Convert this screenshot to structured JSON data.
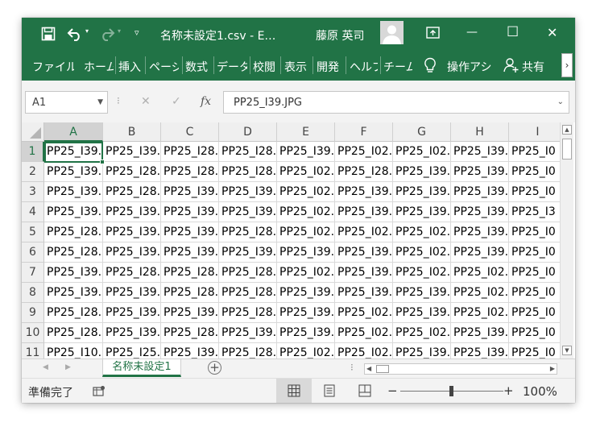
{
  "titlebar": {
    "file_title": "名称未設定1.csv  -  E…",
    "user_name": "藤原 英司",
    "minimize_label": "—",
    "maximize_label": "☐",
    "close_label": "✕"
  },
  "ribbon": {
    "tabs": [
      "ファイル",
      "ホーム",
      "挿入",
      "ページ",
      "数式",
      "データ",
      "校閲",
      "表示",
      "開発",
      "ヘルプ",
      "チーム"
    ],
    "tell_me": "操作アシ",
    "share": "共有",
    "more": "›"
  },
  "formula_bar": {
    "name_box": "A1",
    "fx_label": "fx",
    "cancel_label": "✕",
    "enter_label": "✓",
    "value": "PP25_I39.JPG"
  },
  "sheet": {
    "columns": [
      "A",
      "B",
      "C",
      "D",
      "E",
      "F",
      "G",
      "H",
      "I"
    ],
    "rows": [
      {
        "num": "1",
        "cells": [
          "PP25_I39.",
          "PP25_I39.",
          "PP25_I28.",
          "PP25_I28.",
          "PP25_I39.",
          "PP25_I02.",
          "PP25_I02.",
          "PP25_I39.",
          "PP25_I0"
        ]
      },
      {
        "num": "2",
        "cells": [
          "PP25_I39.",
          "PP25_I28.",
          "PP25_I28.",
          "PP25_I28.",
          "PP25_I02.",
          "PP25_I28.",
          "PP25_I39.",
          "PP25_I39.",
          "PP25_I0"
        ]
      },
      {
        "num": "3",
        "cells": [
          "PP25_I39.",
          "PP25_I28.",
          "PP25_I39.",
          "PP25_I39.",
          "PP25_I02.",
          "PP25_I39.",
          "PP25_I39.",
          "PP25_I39.",
          "PP25_I0"
        ]
      },
      {
        "num": "4",
        "cells": [
          "PP25_I39.",
          "PP25_I39.",
          "PP25_I39.",
          "PP25_I39.",
          "PP25_I02.",
          "PP25_I39.",
          "PP25_I39.",
          "PP25_I39.",
          "PP25_I3"
        ]
      },
      {
        "num": "5",
        "cells": [
          "PP25_I28.",
          "PP25_I39.",
          "PP25_I39.",
          "PP25_I28.",
          "PP25_I02.",
          "PP25_I02.",
          "PP25_I02.",
          "PP25_I39.",
          "PP25_I0"
        ]
      },
      {
        "num": "6",
        "cells": [
          "PP25_I28.",
          "PP25_I39.",
          "PP25_I39.",
          "PP25_I39.",
          "PP25_I39.",
          "PP25_I39.",
          "PP25_I02.",
          "PP25_I39.",
          "PP25_I0"
        ]
      },
      {
        "num": "7",
        "cells": [
          "PP25_I39.",
          "PP25_I28.",
          "PP25_I28.",
          "PP25_I28.",
          "PP25_I02.",
          "PP25_I39.",
          "PP25_I02.",
          "PP25_I02.",
          "PP25_I0"
        ]
      },
      {
        "num": "8",
        "cells": [
          "PP25_I39.",
          "PP25_I39.",
          "PP25_I28.",
          "PP25_I28.",
          "PP25_I39.",
          "PP25_I39.",
          "PP25_I39.",
          "PP25_I02.",
          "PP25_I0"
        ]
      },
      {
        "num": "9",
        "cells": [
          "PP25_I28.",
          "PP25_I39.",
          "PP25_I39.",
          "PP25_I28.",
          "PP25_I39.",
          "PP25_I02.",
          "PP25_I39.",
          "PP25_I02.",
          "PP25_I0"
        ]
      },
      {
        "num": "10",
        "cells": [
          "PP25_I28.",
          "PP25_I39.",
          "PP25_I28.",
          "PP25_I39.",
          "PP25_I39.",
          "PP25_I02.",
          "PP25_I02.",
          "PP25_I39.",
          "PP25_I0"
        ]
      },
      {
        "num": "11",
        "cells": [
          "PP25_I10.",
          "PP25_I25.",
          "PP25_I39.",
          "PP25_I28.",
          "PP25_I02.",
          "PP25_I02.",
          "PP25_I39.",
          "PP25_I39.",
          "PP25_I0"
        ]
      }
    ]
  },
  "sheet_tabs": {
    "active": "名称未設定1",
    "add_label": "+"
  },
  "status": {
    "ready": "準備完了",
    "zoom": "100%",
    "zoom_minus": "−",
    "zoom_plus": "+",
    "zoom_level_percent": 100
  },
  "colors": {
    "accent": "#217346",
    "ribbon_text": "#ffffff",
    "grid_line": "#dadada",
    "header_bg": "#efefef"
  }
}
